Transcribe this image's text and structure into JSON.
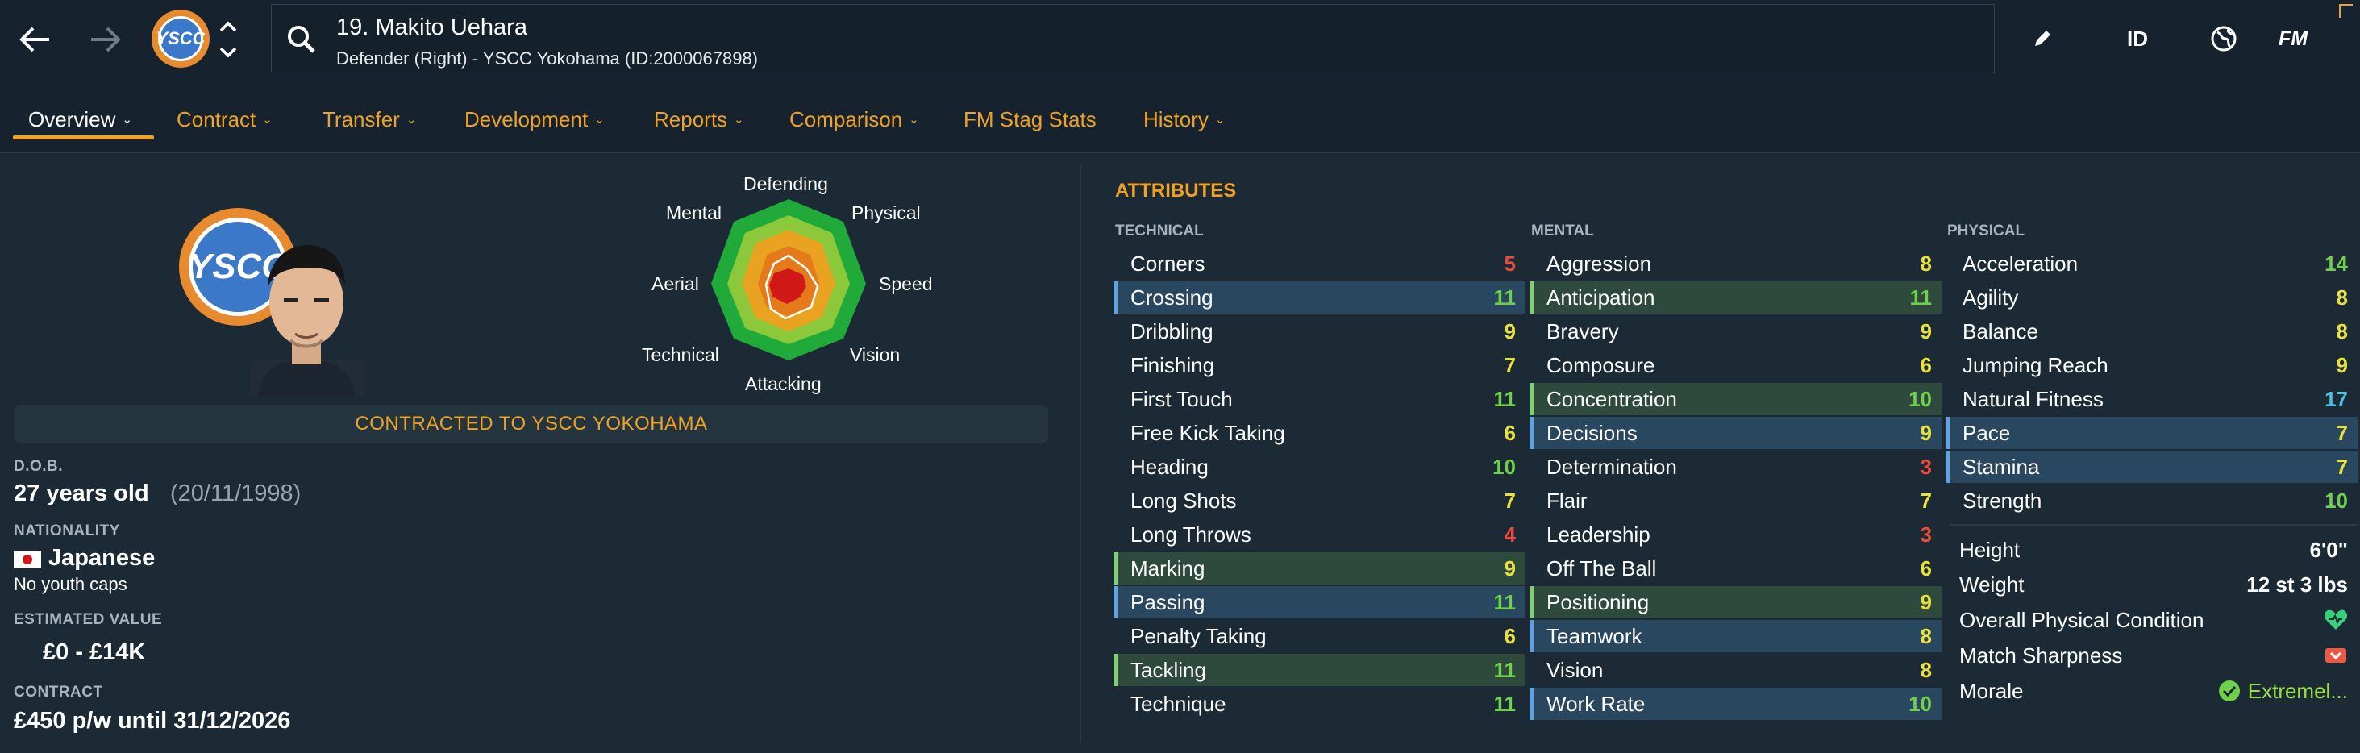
{
  "header": {
    "player_title": "19. Makito Uehara",
    "player_subtitle": "Defender (Right) - YSCC Yokohama (ID:2000067898)",
    "club_abbr": "YSCC",
    "right_icons": {
      "id_label": "ID",
      "fm_label": "FM"
    }
  },
  "tabs": [
    {
      "label": "Overview",
      "active": true
    },
    {
      "label": "Contract"
    },
    {
      "label": "Transfer"
    },
    {
      "label": "Development"
    },
    {
      "label": "Reports"
    },
    {
      "label": "Comparison"
    },
    {
      "label": "FM Stag Stats"
    },
    {
      "label": "History"
    }
  ],
  "overview": {
    "contract_banner": "CONTRACTED TO YSCC YOKOHAMA",
    "dob_label": "D.O.B.",
    "age": "27 years old",
    "dob": "(20/11/1998)",
    "nationality_label": "NATIONALITY",
    "nationality": "Japanese",
    "caps": "No youth caps",
    "value_label": "ESTIMATED VALUE",
    "value": "£0 - £14K",
    "contract_label": "CONTRACT",
    "contract": "£450 p/w until 31/12/2026",
    "radar": {
      "defending": "Defending",
      "physical": "Physical",
      "speed": "Speed",
      "vision": "Vision",
      "attacking": "Attacking",
      "technical": "Technical",
      "aerial": "Aerial",
      "mental": "Mental"
    }
  },
  "attributes": {
    "title": "ATTRIBUTES",
    "technical_label": "TECHNICAL",
    "mental_label": "MENTAL",
    "physical_label": "PHYSICAL",
    "technical": [
      {
        "name": "Corners",
        "value": "5"
      },
      {
        "name": "Crossing",
        "value": "11"
      },
      {
        "name": "Dribbling",
        "value": "9"
      },
      {
        "name": "Finishing",
        "value": "7"
      },
      {
        "name": "First Touch",
        "value": "11"
      },
      {
        "name": "Free Kick Taking",
        "value": "6"
      },
      {
        "name": "Heading",
        "value": "10"
      },
      {
        "name": "Long Shots",
        "value": "7"
      },
      {
        "name": "Long Throws",
        "value": "4"
      },
      {
        "name": "Marking",
        "value": "9"
      },
      {
        "name": "Passing",
        "value": "11"
      },
      {
        "name": "Penalty Taking",
        "value": "6"
      },
      {
        "name": "Tackling",
        "value": "11"
      },
      {
        "name": "Technique",
        "value": "11"
      }
    ],
    "mental": [
      {
        "name": "Aggression",
        "value": "8"
      },
      {
        "name": "Anticipation",
        "value": "11"
      },
      {
        "name": "Bravery",
        "value": "9"
      },
      {
        "name": "Composure",
        "value": "6"
      },
      {
        "name": "Concentration",
        "value": "10"
      },
      {
        "name": "Decisions",
        "value": "9"
      },
      {
        "name": "Determination",
        "value": "3"
      },
      {
        "name": "Flair",
        "value": "7"
      },
      {
        "name": "Leadership",
        "value": "3"
      },
      {
        "name": "Off The Ball",
        "value": "6"
      },
      {
        "name": "Positioning",
        "value": "9"
      },
      {
        "name": "Teamwork",
        "value": "8"
      },
      {
        "name": "Vision",
        "value": "8"
      },
      {
        "name": "Work Rate",
        "value": "10"
      }
    ],
    "physical": [
      {
        "name": "Acceleration",
        "value": "14"
      },
      {
        "name": "Agility",
        "value": "8"
      },
      {
        "name": "Balance",
        "value": "8"
      },
      {
        "name": "Jumping Reach",
        "value": "9"
      },
      {
        "name": "Natural Fitness",
        "value": "17"
      },
      {
        "name": "Pace",
        "value": "7"
      },
      {
        "name": "Stamina",
        "value": "7"
      },
      {
        "name": "Strength",
        "value": "10"
      }
    ],
    "info": {
      "height_label": "Height",
      "height": "6'0\"",
      "weight_label": "Weight",
      "weight": "12 st 3 lbs",
      "condition_label": "Overall Physical Condition",
      "sharpness_label": "Match Sharpness",
      "morale_label": "Morale",
      "morale": "Extremel..."
    }
  },
  "colors": {
    "accent": "#f0a224",
    "low": "#e84a3c",
    "mid": "#e8e23a",
    "good": "#6fd04a",
    "great": "#4cc0e0",
    "bg": "#1b2a35",
    "topbar": "#16222d"
  }
}
